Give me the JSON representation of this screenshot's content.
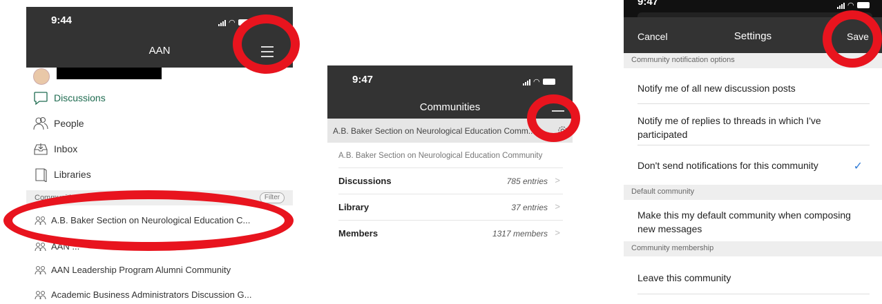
{
  "screen1": {
    "time": "9:44",
    "title": "AAN",
    "menu": [
      {
        "label": "Discussions",
        "icon": "speech-bubble-icon",
        "color": "#1e6b50"
      },
      {
        "label": "People",
        "icon": "people-icon",
        "color": "#333333"
      },
      {
        "label": "Inbox",
        "icon": "inbox-icon",
        "color": "#333333"
      },
      {
        "label": "Libraries",
        "icon": "library-icon",
        "color": "#333333"
      }
    ],
    "communities_header": "Communities",
    "filter_label": "Filter",
    "communities": [
      "A.B. Baker Section on Neurological Education C...",
      "AAN ...",
      "AAN Leadership Program Alumni Community",
      "Academic Business Administrators Discussion G..."
    ]
  },
  "screen2": {
    "time": "9:47",
    "title": "Communities",
    "header_row": "A.B. Baker Section on Neurological Education Comm...",
    "sub_row": "A.B. Baker Section on Neurological Education Community",
    "rows": [
      {
        "label": "Discussions",
        "count": "785 entries"
      },
      {
        "label": "Library",
        "count": "37 entries"
      },
      {
        "label": "Members",
        "count": "1317 members"
      }
    ]
  },
  "screen3": {
    "time": "9:47",
    "cancel": "Cancel",
    "title": "Settings",
    "save": "Save",
    "sections": [
      {
        "header": "Community notification options",
        "options": [
          {
            "label": "Notify me of all new discussion posts",
            "checked": false
          },
          {
            "label": "Notify me of replies to threads in which I've participated",
            "checked": false
          },
          {
            "label": "Don't send notifications for this community",
            "checked": true
          }
        ]
      },
      {
        "header": "Default community",
        "options": [
          {
            "label": "Make this my default community when composing new messages",
            "checked": false
          }
        ]
      },
      {
        "header": "Community membership",
        "options": [
          {
            "label": "Leave this community",
            "checked": false
          }
        ]
      }
    ]
  },
  "colors": {
    "accent_green": "#1e6b50",
    "annotation_red": "#e8141e",
    "check_blue": "#2f7bd6",
    "nav_dark": "#333333"
  }
}
